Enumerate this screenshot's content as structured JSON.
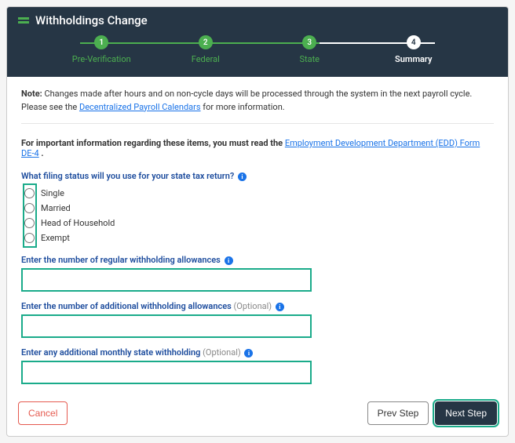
{
  "header": {
    "title": "Withholdings Change"
  },
  "stepper": {
    "steps": [
      {
        "num": "1",
        "label": "Pre-Verification",
        "state": "done"
      },
      {
        "num": "2",
        "label": "Federal",
        "state": "done"
      },
      {
        "num": "3",
        "label": "State",
        "state": "done"
      },
      {
        "num": "4",
        "label": "Summary",
        "state": "active"
      }
    ]
  },
  "note": {
    "prefix": "Note:",
    "text": " Changes made after hours and on non-cycle days will be processed through the system in the next payroll cycle. Please see the ",
    "link": "Decentralized Payroll Calendars",
    "suffix": " for more information."
  },
  "important": {
    "text": "For important information regarding these items, you must read the ",
    "link": "Employment Development Department (EDD) Form DE-4",
    "suffix": " ."
  },
  "form": {
    "q1": "What filing status will you use for your state tax return?",
    "options": {
      "o1": "Single",
      "o2": "Married",
      "o3": "Head of Household",
      "o4": "Exempt"
    },
    "q2": "Enter the number of regular withholding allowances",
    "q3_a": "Enter the number of additional withholding allowances ",
    "q3_opt": "(Optional)",
    "q4_a": "Enter any additional monthly state withholding ",
    "q4_opt": "(Optional)",
    "values": {
      "regular": "",
      "additional": "",
      "monthly": ""
    }
  },
  "footer": {
    "cancel": "Cancel",
    "prev": "Prev Step",
    "next": "Next Step"
  }
}
